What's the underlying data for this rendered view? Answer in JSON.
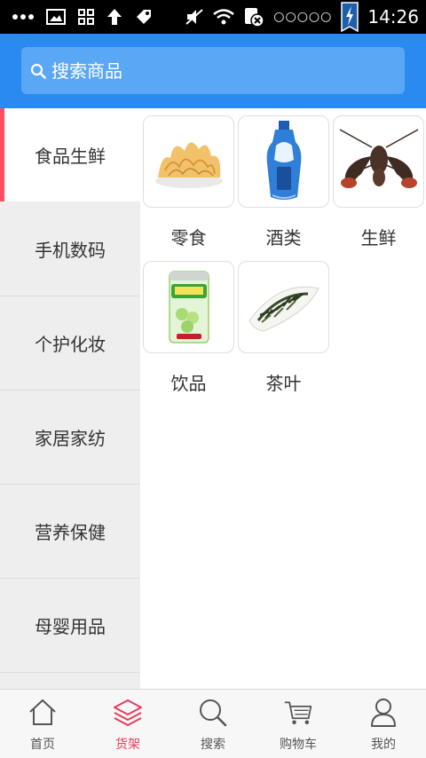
{
  "status_bar": {
    "time": "14:26",
    "sim": "○○○○○",
    "icons": [
      "more-dots-icon",
      "gallery-icon",
      "grid-icon",
      "upload-arrow-icon",
      "tag-icon",
      "mute-icon",
      "wifi-icon",
      "data-icon",
      "battery-charging-icon"
    ]
  },
  "search": {
    "placeholder": "搜索商品",
    "icon": "search-icon"
  },
  "categories": [
    {
      "label": "食品生鲜",
      "active": true
    },
    {
      "label": "手机数码"
    },
    {
      "label": "个护化妆"
    },
    {
      "label": "家居家纺"
    },
    {
      "label": "营养保健"
    },
    {
      "label": "母婴用品"
    }
  ],
  "products": [
    {
      "label": "零食",
      "icon": "snack-image"
    },
    {
      "label": "酒类",
      "icon": "liquor-image"
    },
    {
      "label": "生鲜",
      "icon": "lobster-image"
    },
    {
      "label": "饮品",
      "icon": "drink-can-image"
    },
    {
      "label": "茶叶",
      "icon": "tea-leaves-image"
    }
  ],
  "tabs": [
    {
      "label": "首页",
      "icon": "home-icon"
    },
    {
      "label": "货架",
      "icon": "layers-icon",
      "active": true
    },
    {
      "label": "搜索",
      "icon": "search-icon"
    },
    {
      "label": "购物车",
      "icon": "cart-icon"
    },
    {
      "label": "我的",
      "icon": "user-icon"
    }
  ],
  "colors": {
    "header": "#2b8af0",
    "search_box": "#5aa7f5",
    "accent": "#ff4d63",
    "active_tab": "#e83b5b",
    "sidebar_bg": "#eeeeee"
  }
}
